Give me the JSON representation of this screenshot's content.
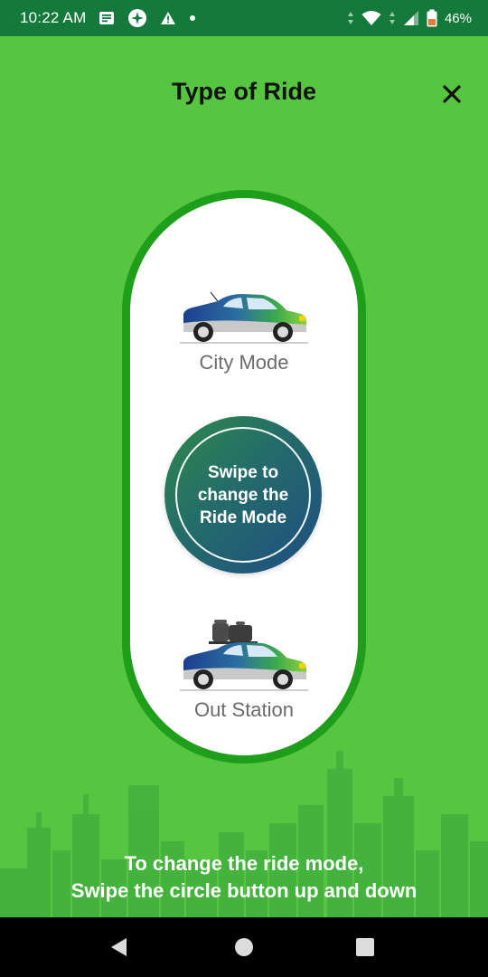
{
  "status_bar": {
    "time": "10:22 AM",
    "battery": "46%",
    "icons": [
      "notes-icon",
      "compass-icon",
      "warning-icon",
      "dot-icon",
      "wifi-icon",
      "signal-icon",
      "battery-icon"
    ]
  },
  "header": {
    "title": "Type of Ride",
    "close_icon": "close-icon"
  },
  "modes": {
    "city": {
      "label": "City Mode",
      "icon": "car-icon"
    },
    "out_station": {
      "label": "Out Station",
      "icon": "car-with-luggage-icon"
    }
  },
  "swipe_button": {
    "line1": "Swipe to",
    "line2": "change the",
    "line3": "Ride Mode"
  },
  "instruction": {
    "line1": "To change the ride mode,",
    "line2": "Swipe the circle button up and down"
  },
  "colors": {
    "background": "#56c540",
    "status_bar": "#147a3b",
    "pill_border": "#1f9e1c",
    "circle_start": "#2f8a4a",
    "circle_end": "#1e4e82"
  },
  "nav_bar": {
    "back_icon": "back-icon",
    "home_icon": "home-icon",
    "recents_icon": "recents-icon"
  }
}
